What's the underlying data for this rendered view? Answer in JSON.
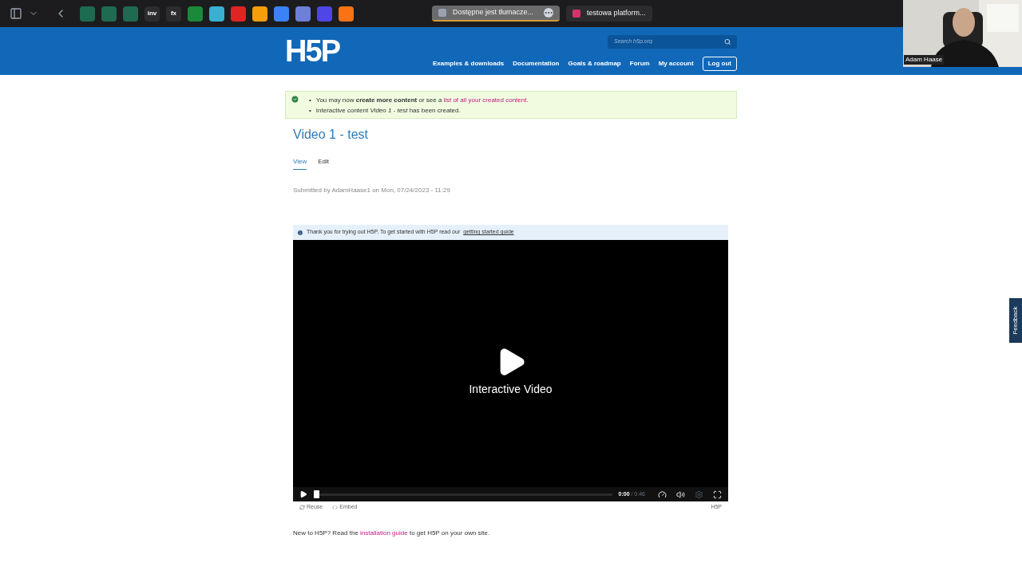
{
  "browser": {
    "pinned": [
      {
        "color": "#1e6b52"
      },
      {
        "color": "#1e6b52"
      },
      {
        "color": "#1e6b52"
      },
      {
        "label": "inv"
      },
      {
        "label": "fx"
      },
      {
        "color": "#1a8a3a"
      },
      {
        "color": "#39b0d0"
      },
      {
        "color": "#e02424"
      },
      {
        "color": "#f59e0b"
      },
      {
        "color": "#3b82f6"
      },
      {
        "color": "#6d7fd8"
      },
      {
        "color": "#4f46e5"
      },
      {
        "color": "#f97316"
      }
    ],
    "tabs": [
      {
        "label": "Dostępne jest tłumacze...",
        "selected": true
      },
      {
        "label": "testowa platform...",
        "selected": false
      }
    ]
  },
  "header": {
    "logo": "H5P",
    "search": {
      "placeholder": "Search h5p.org"
    },
    "nav": [
      "Examples & downloads",
      "Documentation",
      "Goals & roadmap",
      "Forum",
      "My account"
    ],
    "logout": "Log out"
  },
  "messages": [
    {
      "marker": "•",
      "text": "You may now **create more content** or see a "
    },
    {
      "marker": "•",
      "text": "Interactive content *Video 1 - test* has been created."
    }
  ],
  "message_link": "list of all your created content.",
  "title": "Video 1 - test",
  "tabs": [
    {
      "label": "View",
      "selected": true
    },
    {
      "label": "Edit",
      "selected": false
    }
  ],
  "submitted": "Submitted by AdamHaase1 on Mon, 07/24/2023 - 11:29",
  "notice": {
    "text": "Thank you for trying out H5P. To get started with H5P read our",
    "link": "getting started guide"
  },
  "player": {
    "title": "Interactive Video",
    "time": "0:00",
    "duration": "/ 0:46",
    "level": 0,
    "actions": [
      "Reuse",
      "Embed"
    ],
    "brand": "H5P"
  },
  "footer": {
    "before": "New to H5P? Read the",
    "link": "installation guide",
    "after": "to get H5P on your own site."
  },
  "feedback": "Feedback",
  "webcam": {
    "name": "Adam Haase"
  }
}
